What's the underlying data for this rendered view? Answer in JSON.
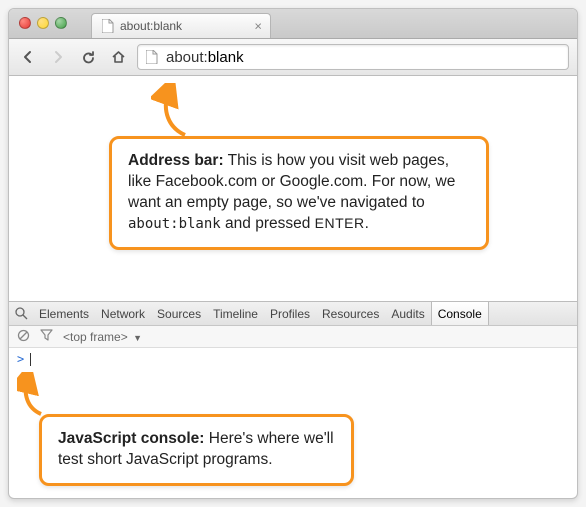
{
  "tab": {
    "title": "about:blank"
  },
  "address": {
    "prefix": "about:",
    "page": "blank"
  },
  "callout1": {
    "title": "Address bar:",
    "body_before": " This is how you visit web pages, like Facebook.com or Google.com. For now, we want an empty page, so we've navigated to ",
    "code": "about:blank",
    "body_mid": " and pressed ",
    "key": "ENTER",
    "body_after": "."
  },
  "callout2": {
    "title": "JavaScript console:",
    "body": " Here's where we'll test short JavaScript programs."
  },
  "devtools": {
    "tabs": [
      "Elements",
      "Network",
      "Sources",
      "Timeline",
      "Profiles",
      "Resources",
      "Audits",
      "Console"
    ],
    "active": "Console",
    "frame_label": "<top frame>",
    "prompt": ">"
  },
  "colors": {
    "accent": "#f7931e"
  }
}
